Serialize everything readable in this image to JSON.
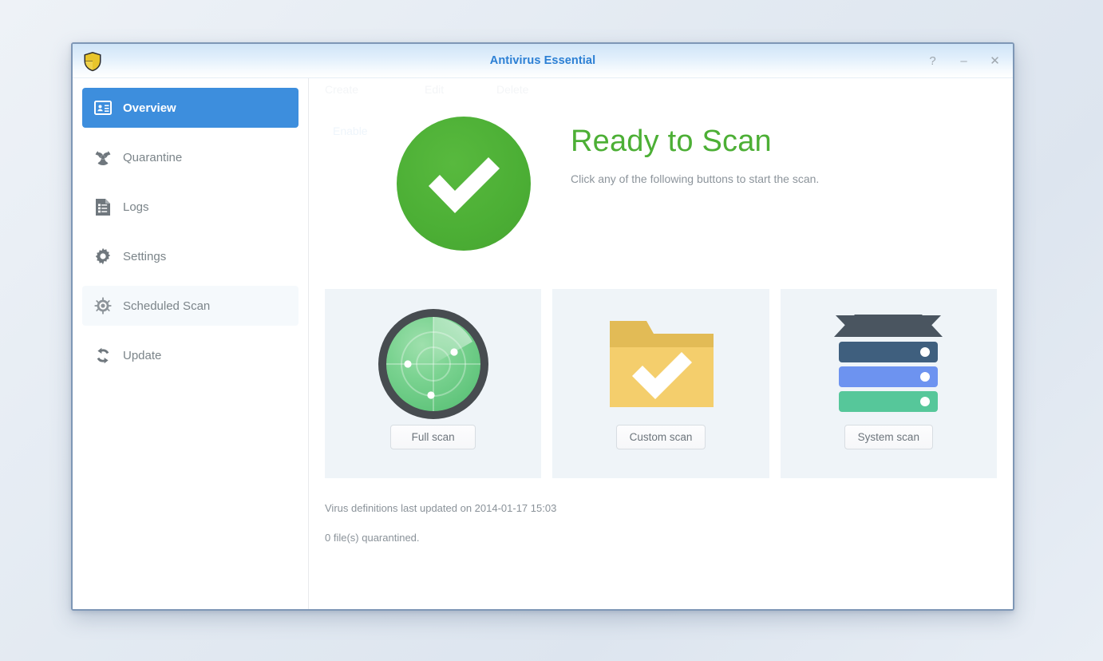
{
  "window": {
    "title": "Antivirus Essential",
    "app_icon": "shield-icon",
    "controls": [
      {
        "name": "help-button",
        "glyph": "?"
      },
      {
        "name": "minimize-button",
        "glyph": "–"
      },
      {
        "name": "close-button",
        "glyph": "✕"
      }
    ]
  },
  "sidebar": {
    "items": [
      {
        "label": "Overview",
        "icon": "id-card-icon",
        "state": "active"
      },
      {
        "label": "Quarantine",
        "icon": "biohazard-icon",
        "state": "normal"
      },
      {
        "label": "Logs",
        "icon": "list-document-icon",
        "state": "normal"
      },
      {
        "label": "Settings",
        "icon": "gear-icon",
        "state": "normal"
      },
      {
        "label": "Scheduled Scan",
        "icon": "target-clock-icon",
        "state": "hovered"
      },
      {
        "label": "Update",
        "icon": "refresh-icon",
        "state": "normal"
      }
    ]
  },
  "ghost_text": {
    "note": "faint residual text from previous panel",
    "items": [
      "Create",
      "Edit",
      "Delete"
    ],
    "checks": [
      "Enable",
      ""
    ]
  },
  "hero": {
    "status_icon": "green-check-circle-icon",
    "title": "Ready to Scan",
    "subtitle": "Click any of the following buttons to start the scan."
  },
  "scan_cards": [
    {
      "icon": "radar-icon",
      "button_label": "Full scan"
    },
    {
      "icon": "folder-check-icon",
      "button_label": "Custom scan"
    },
    {
      "icon": "server-stack-icon",
      "button_label": "System scan"
    }
  ],
  "status": {
    "definitions_line": "Virus definitions last updated on 2014-01-17 15:03",
    "quarantine_line": "0 file(s) quarantined."
  },
  "colors": {
    "accent_blue": "#3d8edd",
    "title_blue": "#2b7fd4",
    "status_green": "#4caf35",
    "card_bg": "#eff4f8",
    "folder_yellow": "#f3cd6a",
    "server_dark": "#4a5560",
    "server_slate": "#3f5f7e",
    "server_blue": "#6d93f0",
    "server_green": "#56c79a",
    "muted_text": "#8a9299"
  }
}
